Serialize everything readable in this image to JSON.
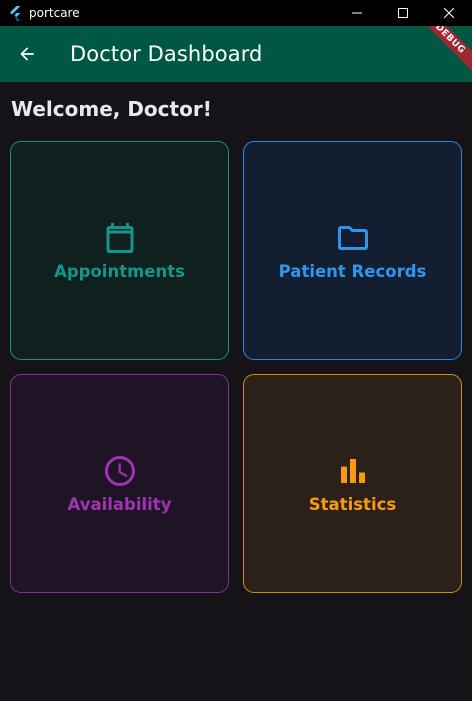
{
  "window": {
    "title": "portcare"
  },
  "appbar": {
    "title": "Doctor Dashboard",
    "debug_banner": "DEBUG",
    "color": "#005844"
  },
  "welcome": {
    "text": "Welcome, Doctor!"
  },
  "cards": [
    {
      "label": "Appointments",
      "icon": "calendar-icon",
      "color": "#14968a"
    },
    {
      "label": "Patient Records",
      "icon": "folder-icon",
      "color": "#2f96f0"
    },
    {
      "label": "Availability",
      "icon": "clock-icon",
      "color": "#a032b4"
    },
    {
      "label": "Statistics",
      "icon": "bar-chart-icon",
      "color": "#f79a12"
    }
  ]
}
